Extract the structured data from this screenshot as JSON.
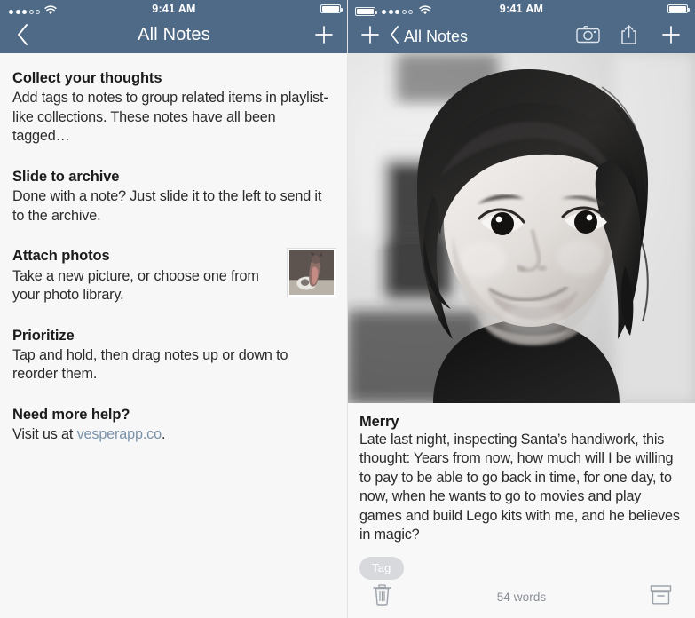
{
  "status_bar": {
    "time": "9:41 AM",
    "signal_dots_filled": 3,
    "signal_dots_empty": 2,
    "wifi_icon": "wifi-icon",
    "battery_icon": "battery-icon"
  },
  "left_pane": {
    "nav": {
      "back_icon": "chevron-left-icon",
      "title": "All Notes",
      "add_icon": "plus-icon"
    },
    "notes": [
      {
        "title": "Collect your thoughts",
        "preview": "Add tags to notes to group related items in playlist-like collections. These notes have all been tagged…",
        "thumbnail": null
      },
      {
        "title": "Slide to archive",
        "preview": "Done with a note? Just slide it to the left to send it to the archive.",
        "thumbnail": null
      },
      {
        "title": "Attach photos",
        "preview": "Take a new picture, or choose one from your photo library.",
        "thumbnail": "dog-photo-thumbnail"
      },
      {
        "title": "Prioritize",
        "preview": "Tap and hold, then drag notes up or down to reorder them.",
        "thumbnail": null
      },
      {
        "title": "Need more help?",
        "preview_before": "Visit us at ",
        "preview_link": "vesperapp.co",
        "preview_after": ".",
        "thumbnail": null
      }
    ]
  },
  "right_pane": {
    "nav": {
      "add_icon": "plus-icon",
      "back_icon": "chevron-left-icon",
      "back_label": "All Notes",
      "camera_icon": "camera-icon",
      "share_icon": "share-icon",
      "plus_icon": "plus-icon"
    },
    "photo": {
      "alt_name": "child-portrait-photo",
      "style": "black-and-white"
    },
    "note": {
      "title": "Merry",
      "text": "Late last night, inspecting Santa’s handiwork, this thought: Years from now, how much will I be willing to pay to be able to go back in time, for one day, to now, when he wants to go to movies and play games and build Lego kits with me, and he believes in magic?"
    },
    "tags": [
      {
        "label": "Tag"
      }
    ],
    "bottom_bar": {
      "delete_icon": "trash-icon",
      "word_count": "54 words",
      "archive_icon": "archive-box-icon"
    }
  },
  "colors": {
    "nav_bar": "#4e6a87",
    "list_background": "#f7f7f7",
    "link": "#7b93ab",
    "tag_chip": "#d7d9dd",
    "muted_text": "#8a8f96"
  }
}
